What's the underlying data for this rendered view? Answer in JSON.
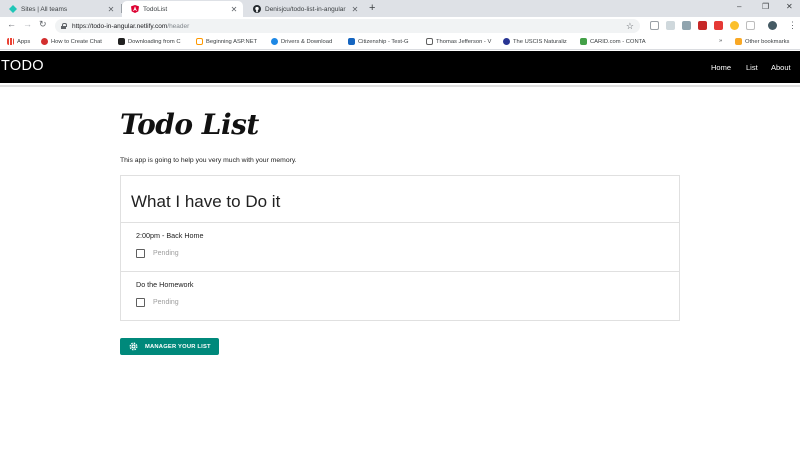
{
  "browser": {
    "tabs": [
      {
        "title": "Sites | All teams",
        "icon": "netlify-diamond-icon",
        "color": "#20c6b7"
      },
      {
        "title": "TodoList",
        "icon": "angular-icon",
        "color": "#dd0031"
      },
      {
        "title": "Denisjcu/todo-list-in-angular",
        "icon": "github-icon",
        "color": "#24292e"
      }
    ],
    "new_tab": "+",
    "window_controls": {
      "minimize": "–",
      "maximize": "❐",
      "close": "✕"
    },
    "url": {
      "host": "https://todo-in-angular.netlify.com",
      "path": "/header"
    },
    "bookmarks": [
      {
        "label": "Apps"
      },
      {
        "label": "How to Create Chat"
      },
      {
        "label": "Downloading from C"
      },
      {
        "label": "Beginning ASP.NET"
      },
      {
        "label": "Drivers & Download"
      },
      {
        "label": "Citizenship - Test-G"
      },
      {
        "label": "Thomas Jefferson - V"
      },
      {
        "label": "The USCIS Naturaliz"
      },
      {
        "label": "CARID.com - CONTA"
      }
    ],
    "other_bookmarks": "Other bookmarks",
    "bookmarks_overflow": "»"
  },
  "navbar": {
    "brand": "TODO",
    "links": [
      "Home",
      "List",
      "About"
    ]
  },
  "page": {
    "title": "Todo List",
    "subtitle": "This app is going to help you very much with your memory."
  },
  "card": {
    "heading": "What I have to Do it",
    "items": [
      {
        "name": "2:00pm - Back Home",
        "status": "Pending",
        "checked": false
      },
      {
        "name": "Do the Homework",
        "status": "Pending",
        "checked": false
      }
    ]
  },
  "action_button": {
    "label": "MANAGER YOUR LIST",
    "icon": "gear-icon",
    "color": "#00897b"
  },
  "colors": {
    "navbar_bg": "#000000",
    "accent": "#00897b"
  }
}
